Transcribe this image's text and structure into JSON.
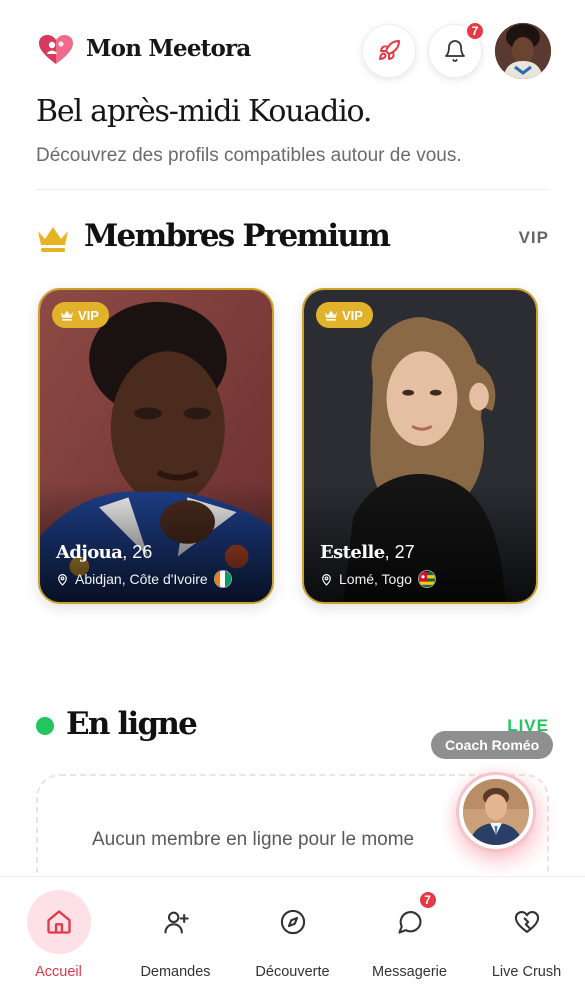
{
  "header": {
    "brand": "Mon Meetora",
    "notifications_count": "7",
    "greeting": "Bel après-midi Kouadio.",
    "subtitle": "Découvrez des profils compatibles autour de vous."
  },
  "premium": {
    "title": "Membres Premium",
    "link": "VIP",
    "cards": [
      {
        "badge": "VIP",
        "name": "Adjoua",
        "age": ", 26",
        "location": "Abidjan, Côte d'Ivoire",
        "flag_icon": "flag-cote-divoire-icon"
      },
      {
        "badge": "VIP",
        "name": "Estelle",
        "age": ", 27",
        "location": "Lomé, Togo",
        "flag_icon": "flag-togo-icon"
      }
    ]
  },
  "online": {
    "title": "En ligne",
    "link": "LIVE",
    "empty_message": "Aucun membre en ligne pour le mome"
  },
  "coach": {
    "label": "Coach Roméo"
  },
  "bottom_nav": {
    "items": [
      {
        "label": "Accueil",
        "icon": "home-icon",
        "active": true
      },
      {
        "label": "Demandes",
        "icon": "user-plus-icon"
      },
      {
        "label": "Découverte",
        "icon": "compass-icon"
      },
      {
        "label": "Messagerie",
        "icon": "chat-bubble-icon",
        "badge": "7"
      },
      {
        "label": "Live Crush",
        "icon": "heart-icon"
      }
    ]
  },
  "colors": {
    "accent": "#e23848",
    "gold": "#e2b22a",
    "online": "#22c55e"
  }
}
